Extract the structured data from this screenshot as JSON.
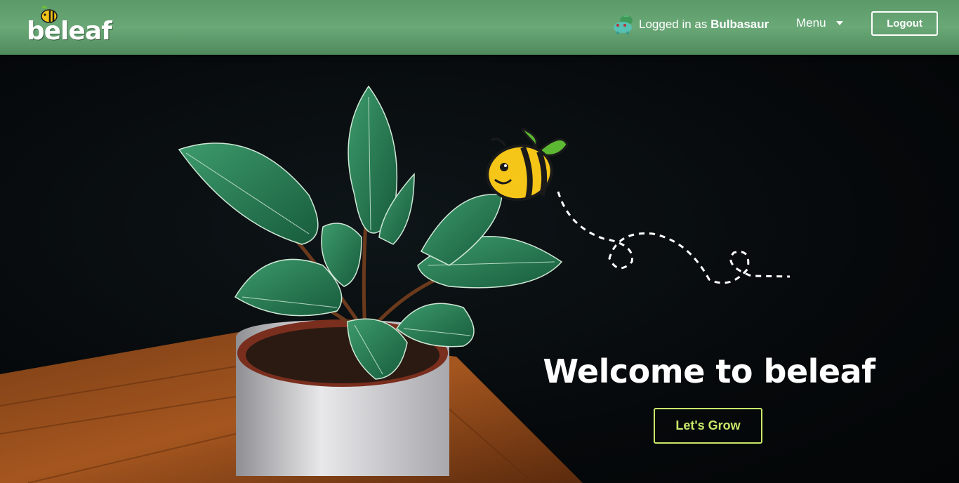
{
  "navbar": {
    "logo_text": "beleaf",
    "user": {
      "prefix": "Logged in as ",
      "name": "Bulbasaur",
      "avatar": "bulbasaur-avatar"
    },
    "menu_label": "Menu",
    "logout_label": "Logout"
  },
  "hero": {
    "title": "Welcome to beleaf",
    "cta_label": "Let's Grow"
  },
  "colors": {
    "navbar_green": "#5b9a68",
    "cta_accent": "#c8e86a",
    "background": "#050709"
  }
}
